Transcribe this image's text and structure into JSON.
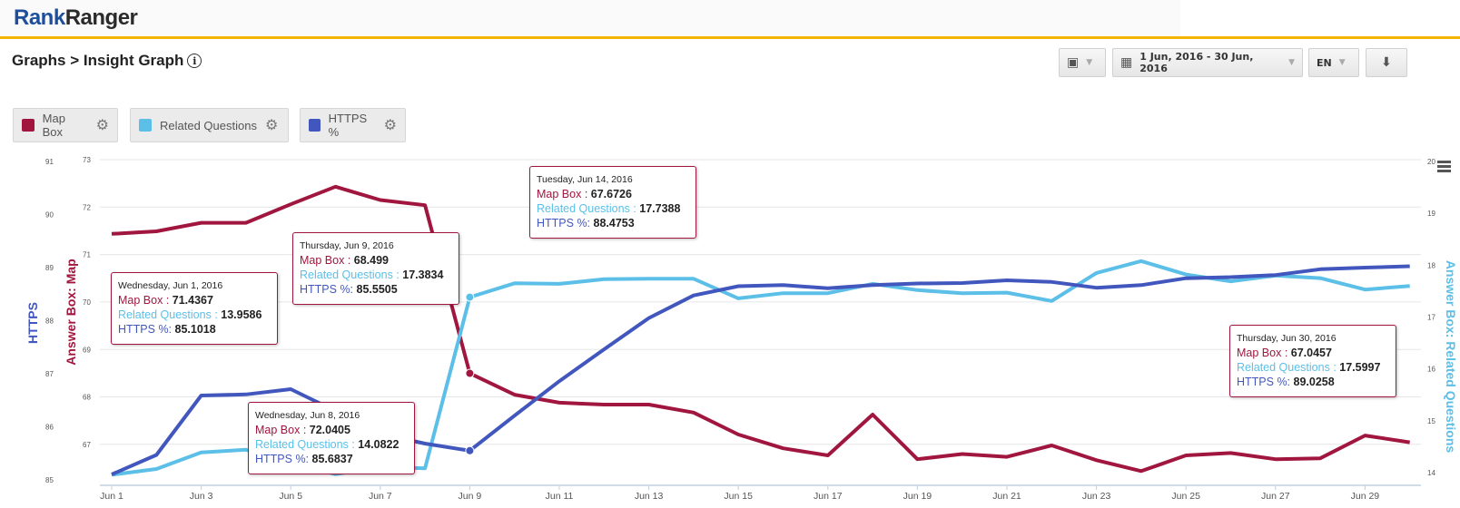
{
  "header": {
    "logo_part1": "Rank",
    "logo_part2": "Ranger"
  },
  "page": {
    "title": "Graphs > Insight Graph",
    "info_icon": "i"
  },
  "toolbar": {
    "date_range": "1 Jun, 2016 - 30 Jun, 2016",
    "language": "EN"
  },
  "legend": [
    {
      "label": "Map Box",
      "color": "#a0163f"
    },
    {
      "label": "Related Questions",
      "color": "#5bbfe8"
    },
    {
      "label": "HTTPS %",
      "color": "#4257bd"
    }
  ],
  "chart_data": {
    "type": "line",
    "x": [
      "Jun 1",
      "Jun 2",
      "Jun 3",
      "Jun 4",
      "Jun 5",
      "Jun 6",
      "Jun 7",
      "Jun 8",
      "Jun 9",
      "Jun 10",
      "Jun 11",
      "Jun 12",
      "Jun 13",
      "Jun 14",
      "Jun 15",
      "Jun 16",
      "Jun 17",
      "Jun 18",
      "Jun 19",
      "Jun 20",
      "Jun 21",
      "Jun 22",
      "Jun 23",
      "Jun 24",
      "Jun 25",
      "Jun 26",
      "Jun 27",
      "Jun 28",
      "Jun 29",
      "Jun 30"
    ],
    "x_ticks": [
      "Jun 1",
      "Jun 3",
      "Jun 5",
      "Jun 7",
      "Jun 9",
      "Jun 11",
      "Jun 13",
      "Jun 15",
      "Jun 17",
      "Jun 19",
      "Jun 21",
      "Jun 23",
      "Jun 25",
      "Jun 27",
      "Jun 29"
    ],
    "axes": {
      "map": {
        "label": "Answer Box: Map",
        "ticks": [
          "73",
          "72",
          "71",
          "70",
          "69",
          "68",
          "67"
        ],
        "range": [
          67,
          73
        ]
      },
      "https": {
        "label": "HTTPS",
        "ticks": [
          "91",
          "90",
          "89",
          "88",
          "87",
          "86",
          "85"
        ],
        "range": [
          85,
          91
        ]
      },
      "rq": {
        "label": "Answer Box: Related Questions",
        "ticks": [
          "20",
          "19",
          "18",
          "17",
          "16",
          "15",
          "14"
        ],
        "range": [
          14,
          20
        ]
      }
    },
    "series": [
      {
        "name": "Map Box",
        "axis": "map",
        "color": "#a0163f",
        "values": [
          71.4367,
          71.49,
          71.67,
          71.67,
          72.06,
          72.43,
          72.15,
          72.0405,
          68.499,
          68.05,
          67.88,
          67.84,
          67.84,
          67.6726,
          67.21,
          66.92,
          66.77,
          67.63,
          66.69,
          66.8,
          66.74,
          66.98,
          66.67,
          66.44,
          66.77,
          66.82,
          66.69,
          66.71,
          67.19,
          67.0457
        ]
      },
      {
        "name": "Related Questions",
        "axis": "rq",
        "color": "#5bbfe8",
        "values": [
          13.9586,
          14.07,
          14.39,
          14.44,
          14.2,
          13.97,
          14.11,
          14.0822,
          17.3834,
          17.65,
          17.64,
          17.73,
          17.74,
          17.7388,
          17.36,
          17.46,
          17.46,
          17.64,
          17.52,
          17.46,
          17.47,
          17.31,
          17.85,
          18.08,
          17.82,
          17.69,
          17.8,
          17.75,
          17.53,
          17.5997
        ]
      },
      {
        "name": "HTTPS %",
        "axis": "https",
        "color": "#4257bd",
        "values": [
          85.1018,
          85.47,
          86.59,
          86.61,
          86.71,
          86.3,
          85.87,
          85.6837,
          85.5505,
          86.21,
          86.86,
          87.46,
          88.05,
          88.4753,
          88.65,
          88.67,
          88.61,
          88.67,
          88.7,
          88.71,
          88.76,
          88.73,
          88.62,
          88.67,
          88.8,
          88.82,
          88.86,
          88.97,
          89.0,
          89.0258
        ]
      }
    ],
    "tooltips": [
      {
        "date": "Wednesday, Jun 1, 2016",
        "map_label": "Map Box",
        "map": "71.4367",
        "rq_label": "Related Questions",
        "rq": "13.9586",
        "https_label": "HTTPS %:",
        "https": "85.1018"
      },
      {
        "date": "Thursday, Jun 9, 2016",
        "map_label": "Map Box",
        "map": "68.499",
        "rq_label": "Related Questions",
        "rq": "17.3834",
        "https_label": "HTTPS %:",
        "https": "85.5505"
      },
      {
        "date": "Wednesday, Jun 8, 2016",
        "map_label": "Map Box",
        "map": "72.0405",
        "rq_label": "Related Questions",
        "rq": "14.0822",
        "https_label": "HTTPS %:",
        "https": "85.6837"
      },
      {
        "date": "Tuesday, Jun 14, 2016",
        "map_label": "Map Box",
        "map": "67.6726",
        "rq_label": "Related Questions",
        "rq": "17.7388",
        "https_label": "HTTPS %:",
        "https": "88.4753"
      },
      {
        "date": "Thursday, Jun 30, 2016",
        "map_label": "Map Box",
        "map": "67.0457",
        "rq_label": "Related Questions",
        "rq": "17.5997",
        "https_label": "HTTPS %:",
        "https": "89.0258"
      }
    ]
  }
}
